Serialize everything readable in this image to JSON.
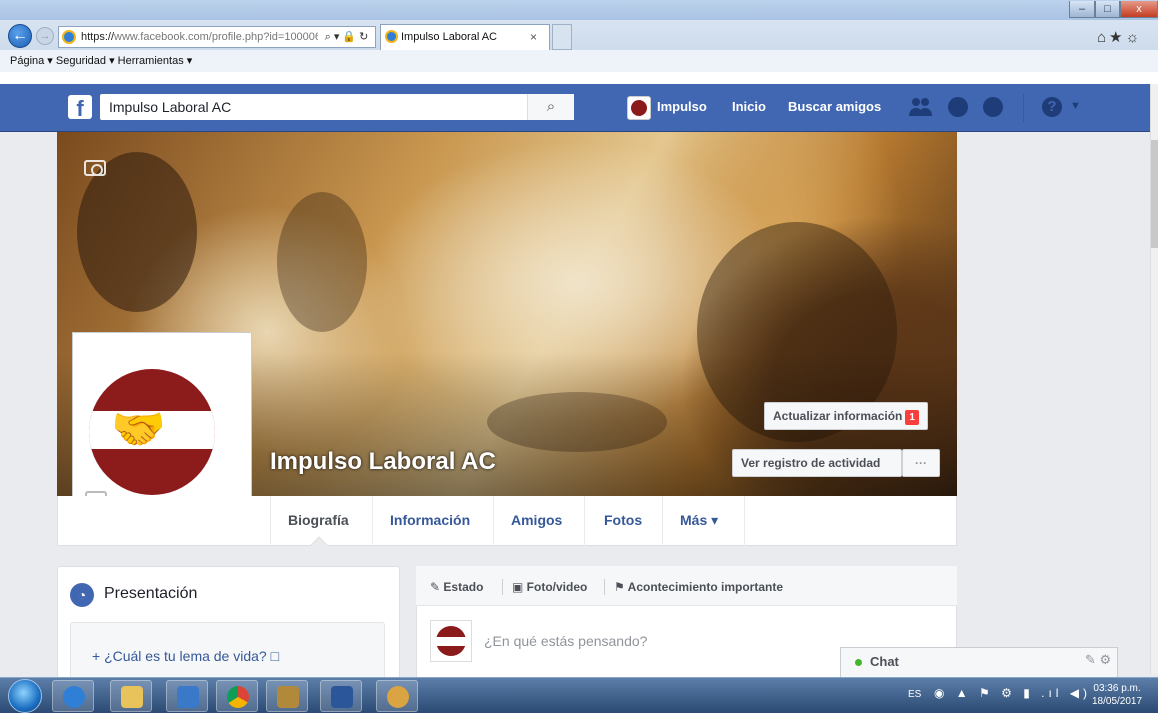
{
  "browser": {
    "url_https": "https://",
    "url_rest": "www.facebook.com/profile.php?id=100006",
    "address_controls": "⌕ ▾ 🔒 ↻",
    "tab_title": "Impulso Laboral AC",
    "tab_close": "×",
    "window_min": "–",
    "window_max": "□",
    "window_close": "x",
    "command_bar": "Página ▾   Seguridad ▾   Herramientas ▾",
    "back_glyph": "←",
    "forward_glyph": "→",
    "fav_icons": "⌂★☼"
  },
  "fb_header": {
    "search_value": "Impulso Laboral AC",
    "logo": "f",
    "search_glyph": "⌕",
    "nav_profile": "Impulso",
    "nav_home": "Inicio",
    "nav_find_friends": "Buscar amigos",
    "help_glyph": "?",
    "caret": "▼"
  },
  "profile": {
    "name": "Impulso Laboral AC",
    "btn_update": "Actualizar información",
    "update_badge": "1",
    "btn_activity": "Ver registro de actividad",
    "btn_more": "···",
    "hands_glyph": "🤝"
  },
  "timeline_nav": {
    "biografia": "Biografía",
    "informacion": "Información",
    "amigos": "Amigos",
    "fotos": "Fotos",
    "mas": "Más ▾"
  },
  "intro": {
    "title": "Presentación",
    "icon_glyph": "◔",
    "motto_prompt": "+  ¿Cuál es tu lema de vida? □"
  },
  "composer": {
    "tab_status": "✎ Estado",
    "tab_photo": "▣ Foto/video",
    "tab_event": "⚑ Acontecimiento importante",
    "placeholder": "¿En qué estás pensando?"
  },
  "chat": {
    "label": "Chat",
    "icons": "✎ ⚙"
  },
  "taskbar": {
    "lang": "ES",
    "tray_icons": "◉ ▲ ⚑ ⚙ ▮ .ıl ◀)",
    "time": "03:36 p.m.",
    "date": "18/05/2017"
  },
  "colors": {
    "fb_blue": "#4267b2",
    "link_blue": "#365899",
    "brand_red": "#8c1b1c",
    "badge_red": "#fa3e3e"
  }
}
